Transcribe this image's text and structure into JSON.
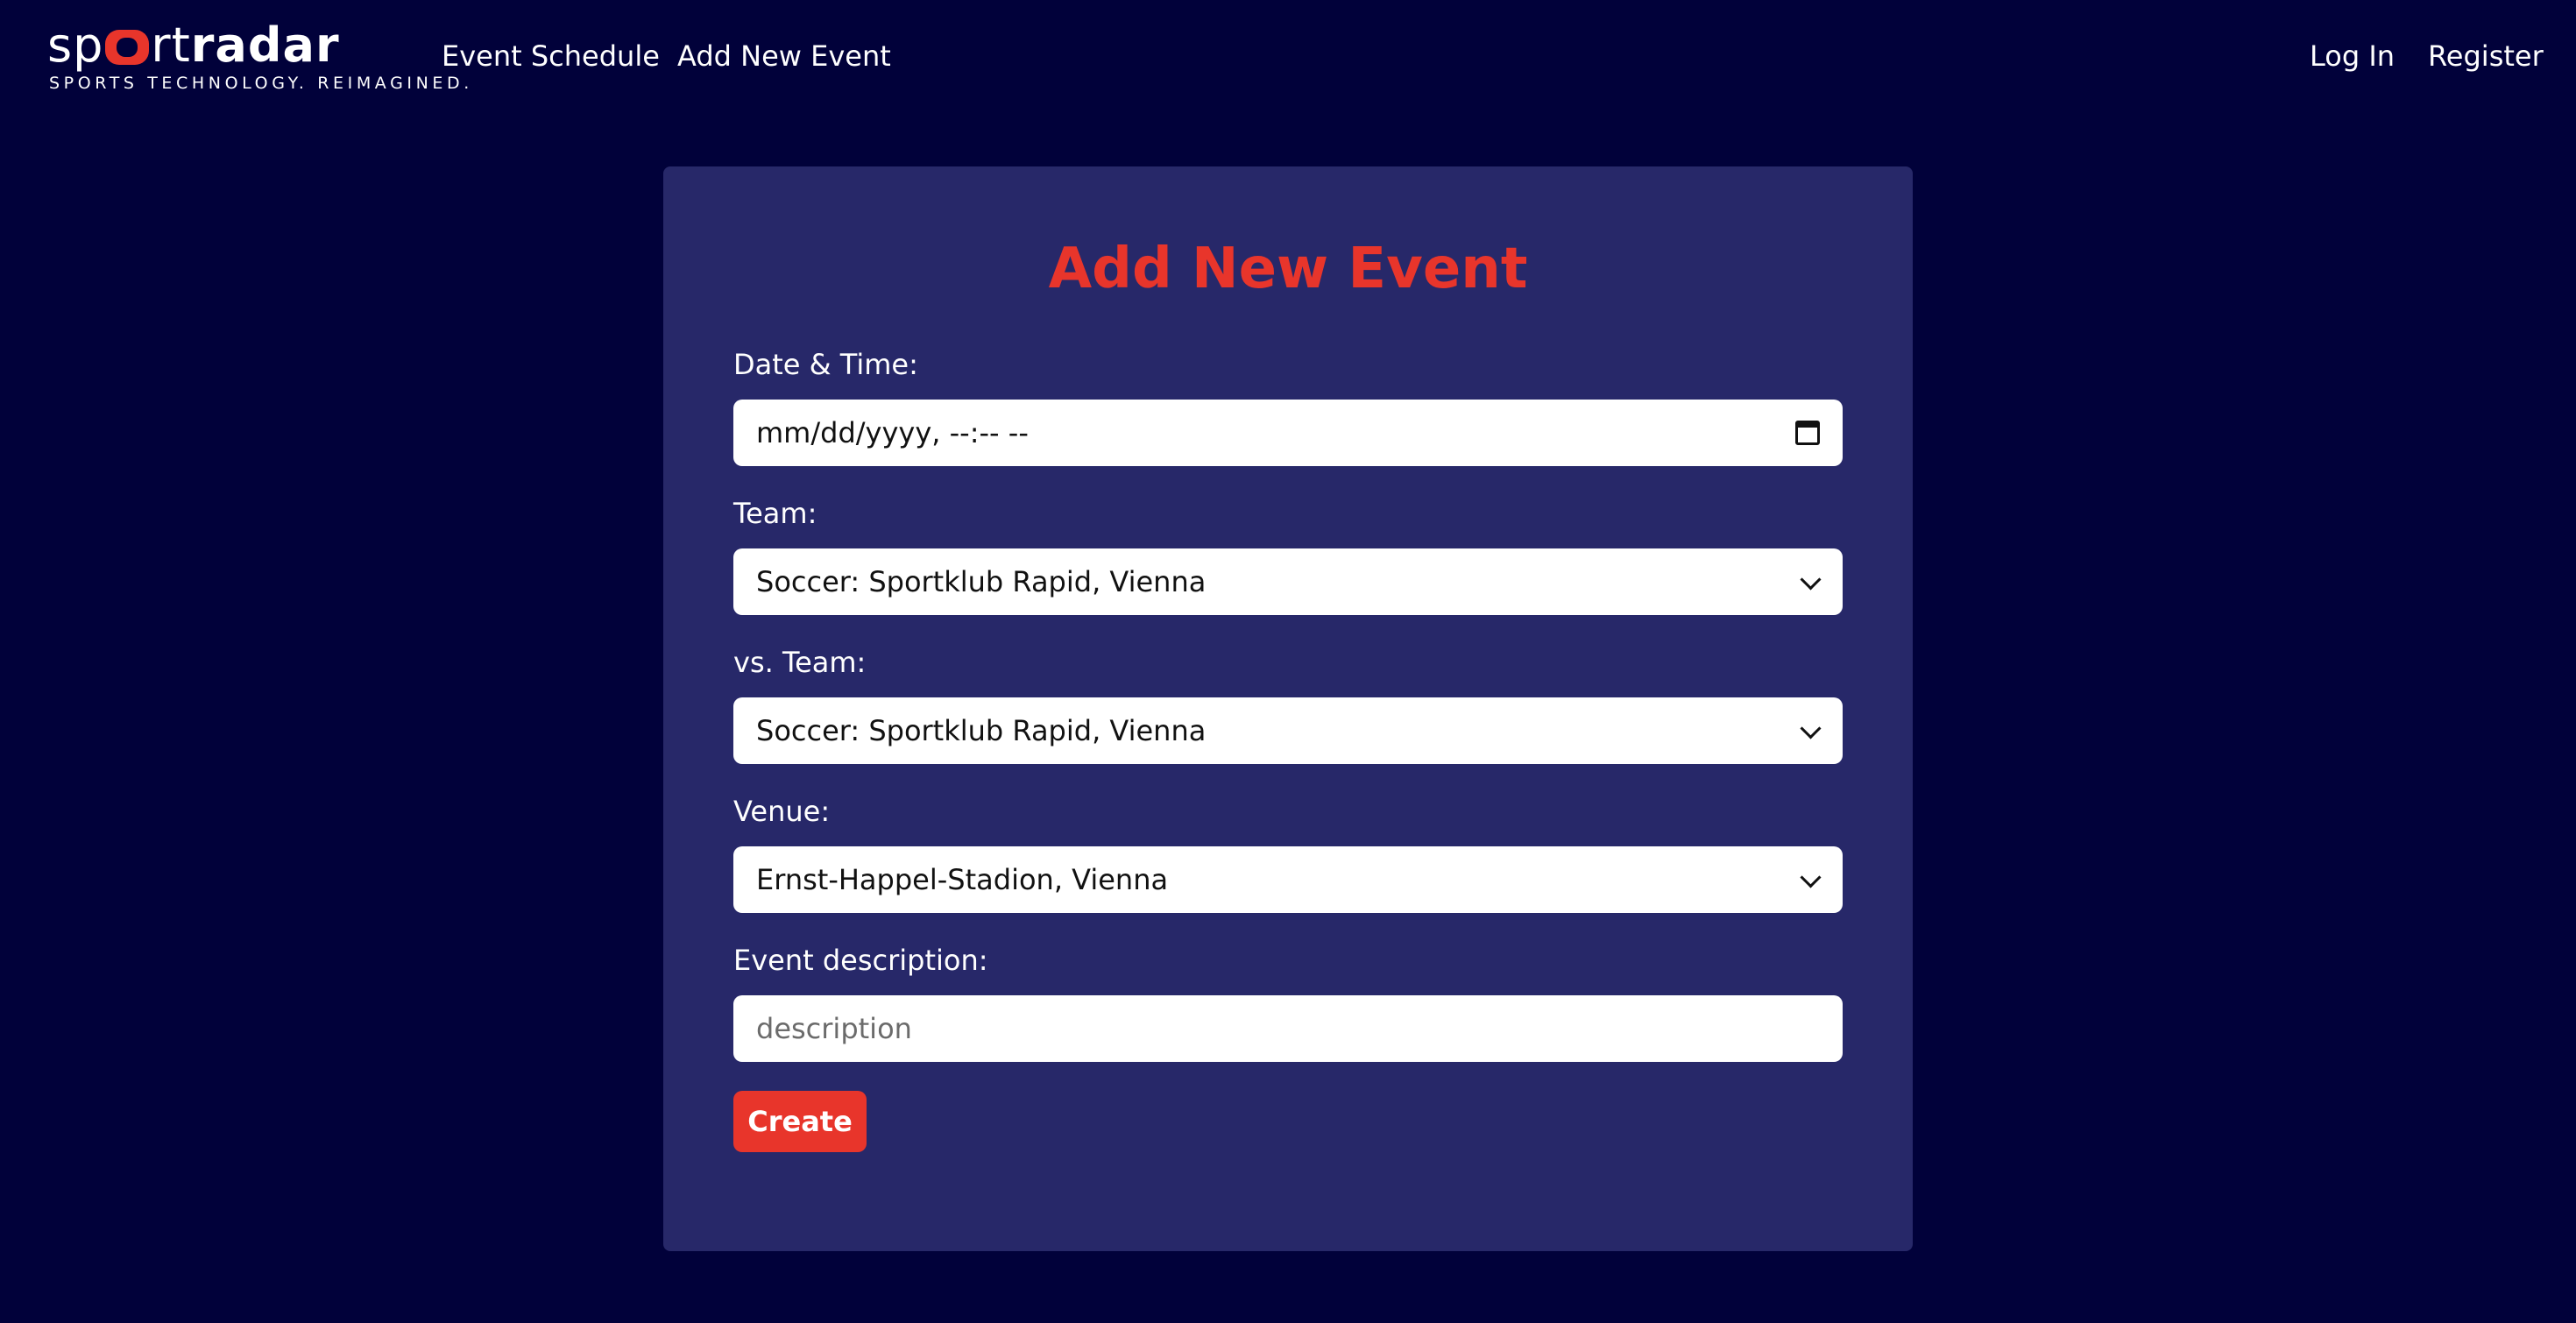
{
  "brand": {
    "name_light": "sp",
    "name_mid": "rt",
    "name_bold": "radar",
    "tagline": "SPORTS TECHNOLOGY. REIMAGINED.",
    "accent_color": "#e8352b"
  },
  "nav": {
    "event_schedule": "Event Schedule",
    "add_new_event": "Add New Event",
    "log_in": "Log In",
    "register": "Register"
  },
  "form": {
    "title": "Add New Event",
    "datetime_label": "Date & Time:",
    "datetime_value": "mm/dd/yyyy, --:-- --",
    "team_label": "Team:",
    "team_value": "Soccer: Sportklub Rapid, Vienna",
    "vs_team_label": "vs. Team:",
    "vs_team_value": "Soccer: Sportklub Rapid, Vienna",
    "venue_label": "Venue:",
    "venue_value": "Ernst-Happel-Stadion, Vienna",
    "description_label": "Event description:",
    "description_placeholder": "description",
    "create_label": "Create"
  },
  "colors": {
    "page_background": "#01013a",
    "card_background": "#272869",
    "title_color": "#e8352b",
    "button_color": "#e8352b"
  }
}
